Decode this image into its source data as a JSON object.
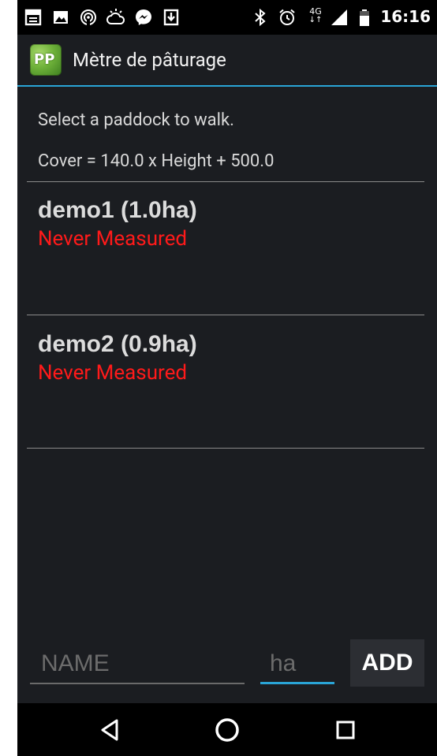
{
  "status_bar": {
    "time": "16:16",
    "network": "4G",
    "icons": [
      "news-icon",
      "image-icon",
      "hotspot-icon",
      "weather-icon",
      "messenger-icon",
      "download-icon",
      "bluetooth-icon",
      "alarm-icon",
      "network-4g-icon",
      "signal-icon",
      "battery-icon"
    ]
  },
  "action_bar": {
    "logo_text": "PP",
    "title": "Mètre de pâturage"
  },
  "main": {
    "hint": "Select a paddock to walk.",
    "formula": "Cover = 140.0 x Height + 500.0",
    "paddocks": [
      {
        "name": "demo1 (1.0ha)",
        "status": "Never Measured"
      },
      {
        "name": "demo2 (0.9ha)",
        "status": "Never Measured"
      }
    ]
  },
  "form": {
    "name_placeholder": "NAME",
    "ha_placeholder": "ha",
    "add_label": "ADD"
  },
  "nav_bar": {
    "buttons": [
      "back-icon",
      "home-icon",
      "recents-icon"
    ]
  },
  "colors": {
    "background": "#1b1d21",
    "accent": "#2aa4d6",
    "status_red": "#ff1a1a"
  }
}
